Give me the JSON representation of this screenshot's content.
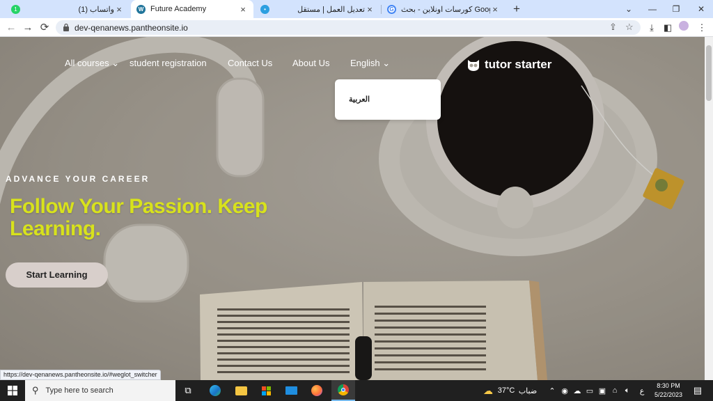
{
  "browser": {
    "tabs": [
      {
        "title": "(1) واتساب",
        "favicon": "whatsapp-icon",
        "favicon_color": "#25d366",
        "active": false
      },
      {
        "title": "Future Academy",
        "favicon": "wordpress-icon",
        "favicon_color": "#21759b",
        "active": true
      },
      {
        "title": "تعديل العمل | مستقل",
        "favicon": "mostaql-icon",
        "favicon_color": "#2c9fe0",
        "active": false
      },
      {
        "title": "كورسات اونلاين - بحث Google",
        "favicon": "google-icon",
        "favicon_color": "#4285f4",
        "active": false
      }
    ],
    "new_tab": "+",
    "window_controls": {
      "list": "⌄",
      "minimize": "—",
      "restore": "❐",
      "close": "✕"
    },
    "url": "dev-qenanews.pantheonsite.io"
  },
  "site": {
    "nav": {
      "all_courses": "All courses",
      "student_registration": "student registration",
      "contact_us": "Contact Us",
      "about_us": "About Us",
      "language": "English"
    },
    "brand": "tutor starter",
    "language_dropdown": {
      "option_arabic": "العربية"
    },
    "hero": {
      "eyebrow": "ADVANCE YOUR CAREER",
      "headline": "Follow Your Passion. Keep Learning.",
      "cta": "Start Learning"
    },
    "status_url": "https://dev-qenanews.pantheonsite.io/#weglot_switcher"
  },
  "taskbar": {
    "search_placeholder": "Type here to search",
    "weather_temp": "37°C",
    "weather_desc": "ضباب",
    "input_lang": "ع",
    "time": "8:30 PM",
    "date": "5/22/2023"
  },
  "colors": {
    "headline": "#d8e21c",
    "cta_bg": "#d8cfcb",
    "tab_strip": "#d3e3fd",
    "taskbar": "#202020"
  }
}
